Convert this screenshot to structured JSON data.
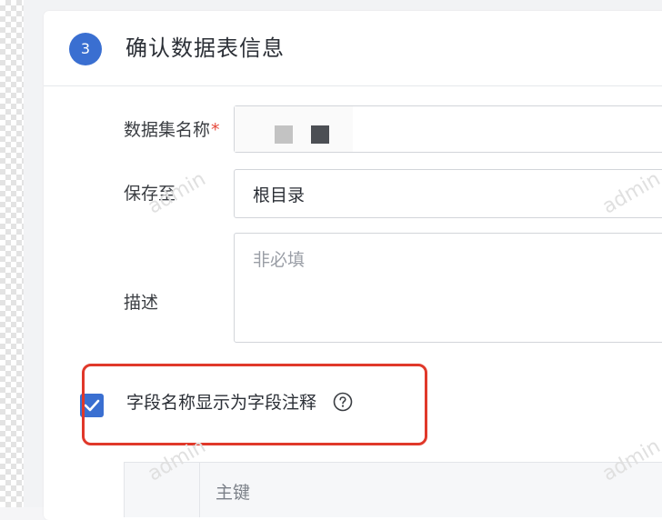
{
  "step": {
    "number": "3",
    "title": "确认数据表信息"
  },
  "form": {
    "dataset_name_label": "数据集名称",
    "required_mark": "*",
    "save_to_label": "保存至",
    "save_to_value": "根目录",
    "description_label": "描述",
    "description_placeholder": "非必填"
  },
  "option": {
    "checked": true,
    "label": "字段名称显示为字段注释"
  },
  "table": {
    "headers": [
      "",
      "主键"
    ]
  },
  "watermark": "admin",
  "colors": {
    "accent": "#3a6fd1",
    "highlight": "#e0382a",
    "required": "#e5483b"
  }
}
